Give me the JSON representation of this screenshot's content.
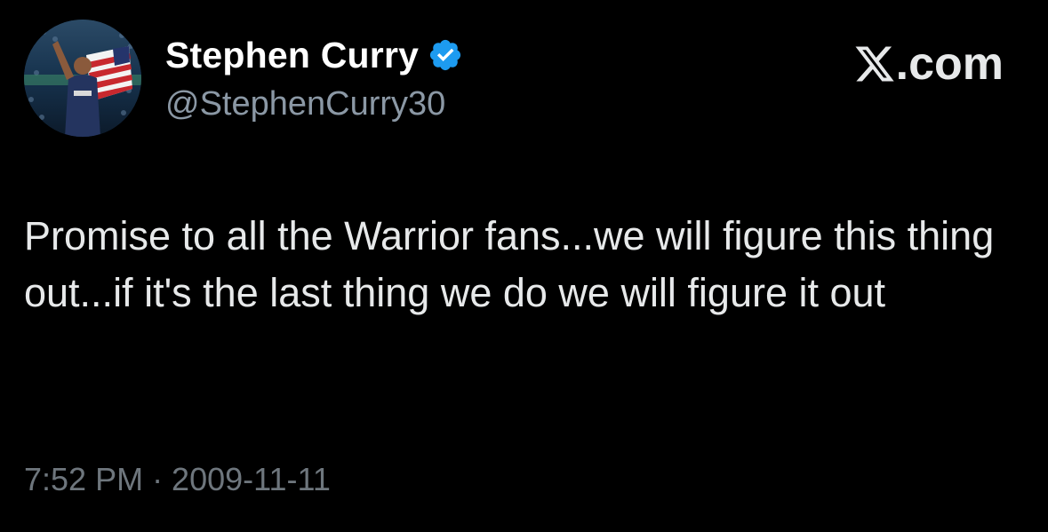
{
  "author": {
    "display_name": "Stephen Curry",
    "handle": "@StephenCurry30",
    "verified": true,
    "avatar_icon": "avatar-player-with-flag"
  },
  "brand": {
    "text": ".com",
    "icon": "x-logo-icon"
  },
  "tweet": {
    "text": "Promise to all the Warrior fans...we will figure this thing out...if it's the last thing we do we will figure it out",
    "timestamp": "7:52 PM · 2009-11-11"
  },
  "colors": {
    "background": "#000000",
    "text_primary": "#e7e9ea",
    "text_secondary": "#8b98a5",
    "timestamp": "#6e767d",
    "verified_blue": "#1d9bf0"
  }
}
